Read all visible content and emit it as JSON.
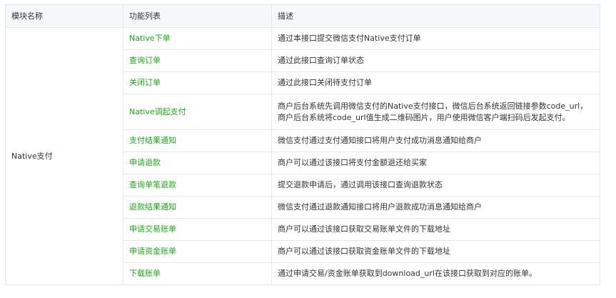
{
  "table": {
    "headers": [
      "模块名称",
      "功能列表",
      "描述"
    ],
    "module": "Native支付",
    "rows": [
      {
        "func": "Native下单",
        "desc": "通过本接口提交微信支付Native支付订单"
      },
      {
        "func": "查询订单",
        "desc": "通过此接口查询订单状态"
      },
      {
        "func": "关闭订单",
        "desc": "通过此接口关闭待支付订单"
      },
      {
        "func": "Native调起支付",
        "desc": "商户后台系统先调用微信支付的Native支付接口，微信后台系统返回链接参数code_url，商户后台系统将code_url值生成二维码图片，用户使用微信客户端扫码后发起支付。"
      },
      {
        "func": "支付结果通知",
        "desc": "微信支付通过支付通知接口将用户支付成功消息通知给商户"
      },
      {
        "func": "申请退款",
        "desc": "商户可以通过该接口将支付金额退还给买家"
      },
      {
        "func": "查询单笔退款",
        "desc": "提交退款申请后，通过调用该接口查询退款状态"
      },
      {
        "func": "退款结果通知",
        "desc": "微信支付通过退款通知接口将用户退款成功消息通知给商户"
      },
      {
        "func": "申请交易账单",
        "desc": "商户可以通过该接口获取交易账单文件的下载地址"
      },
      {
        "func": "申请资金账单",
        "desc": "商户可以通过该接口获取资金账单文件的下载地址"
      },
      {
        "func": "下载账单",
        "desc": "通过申请交易/资金账单获取到download_url在该接口获取到对应的账单。"
      }
    ]
  },
  "colors": {
    "link": "#1aad19",
    "header_bg": "#f5f7fa",
    "border": "#e3e6ea",
    "text": "#333333"
  }
}
